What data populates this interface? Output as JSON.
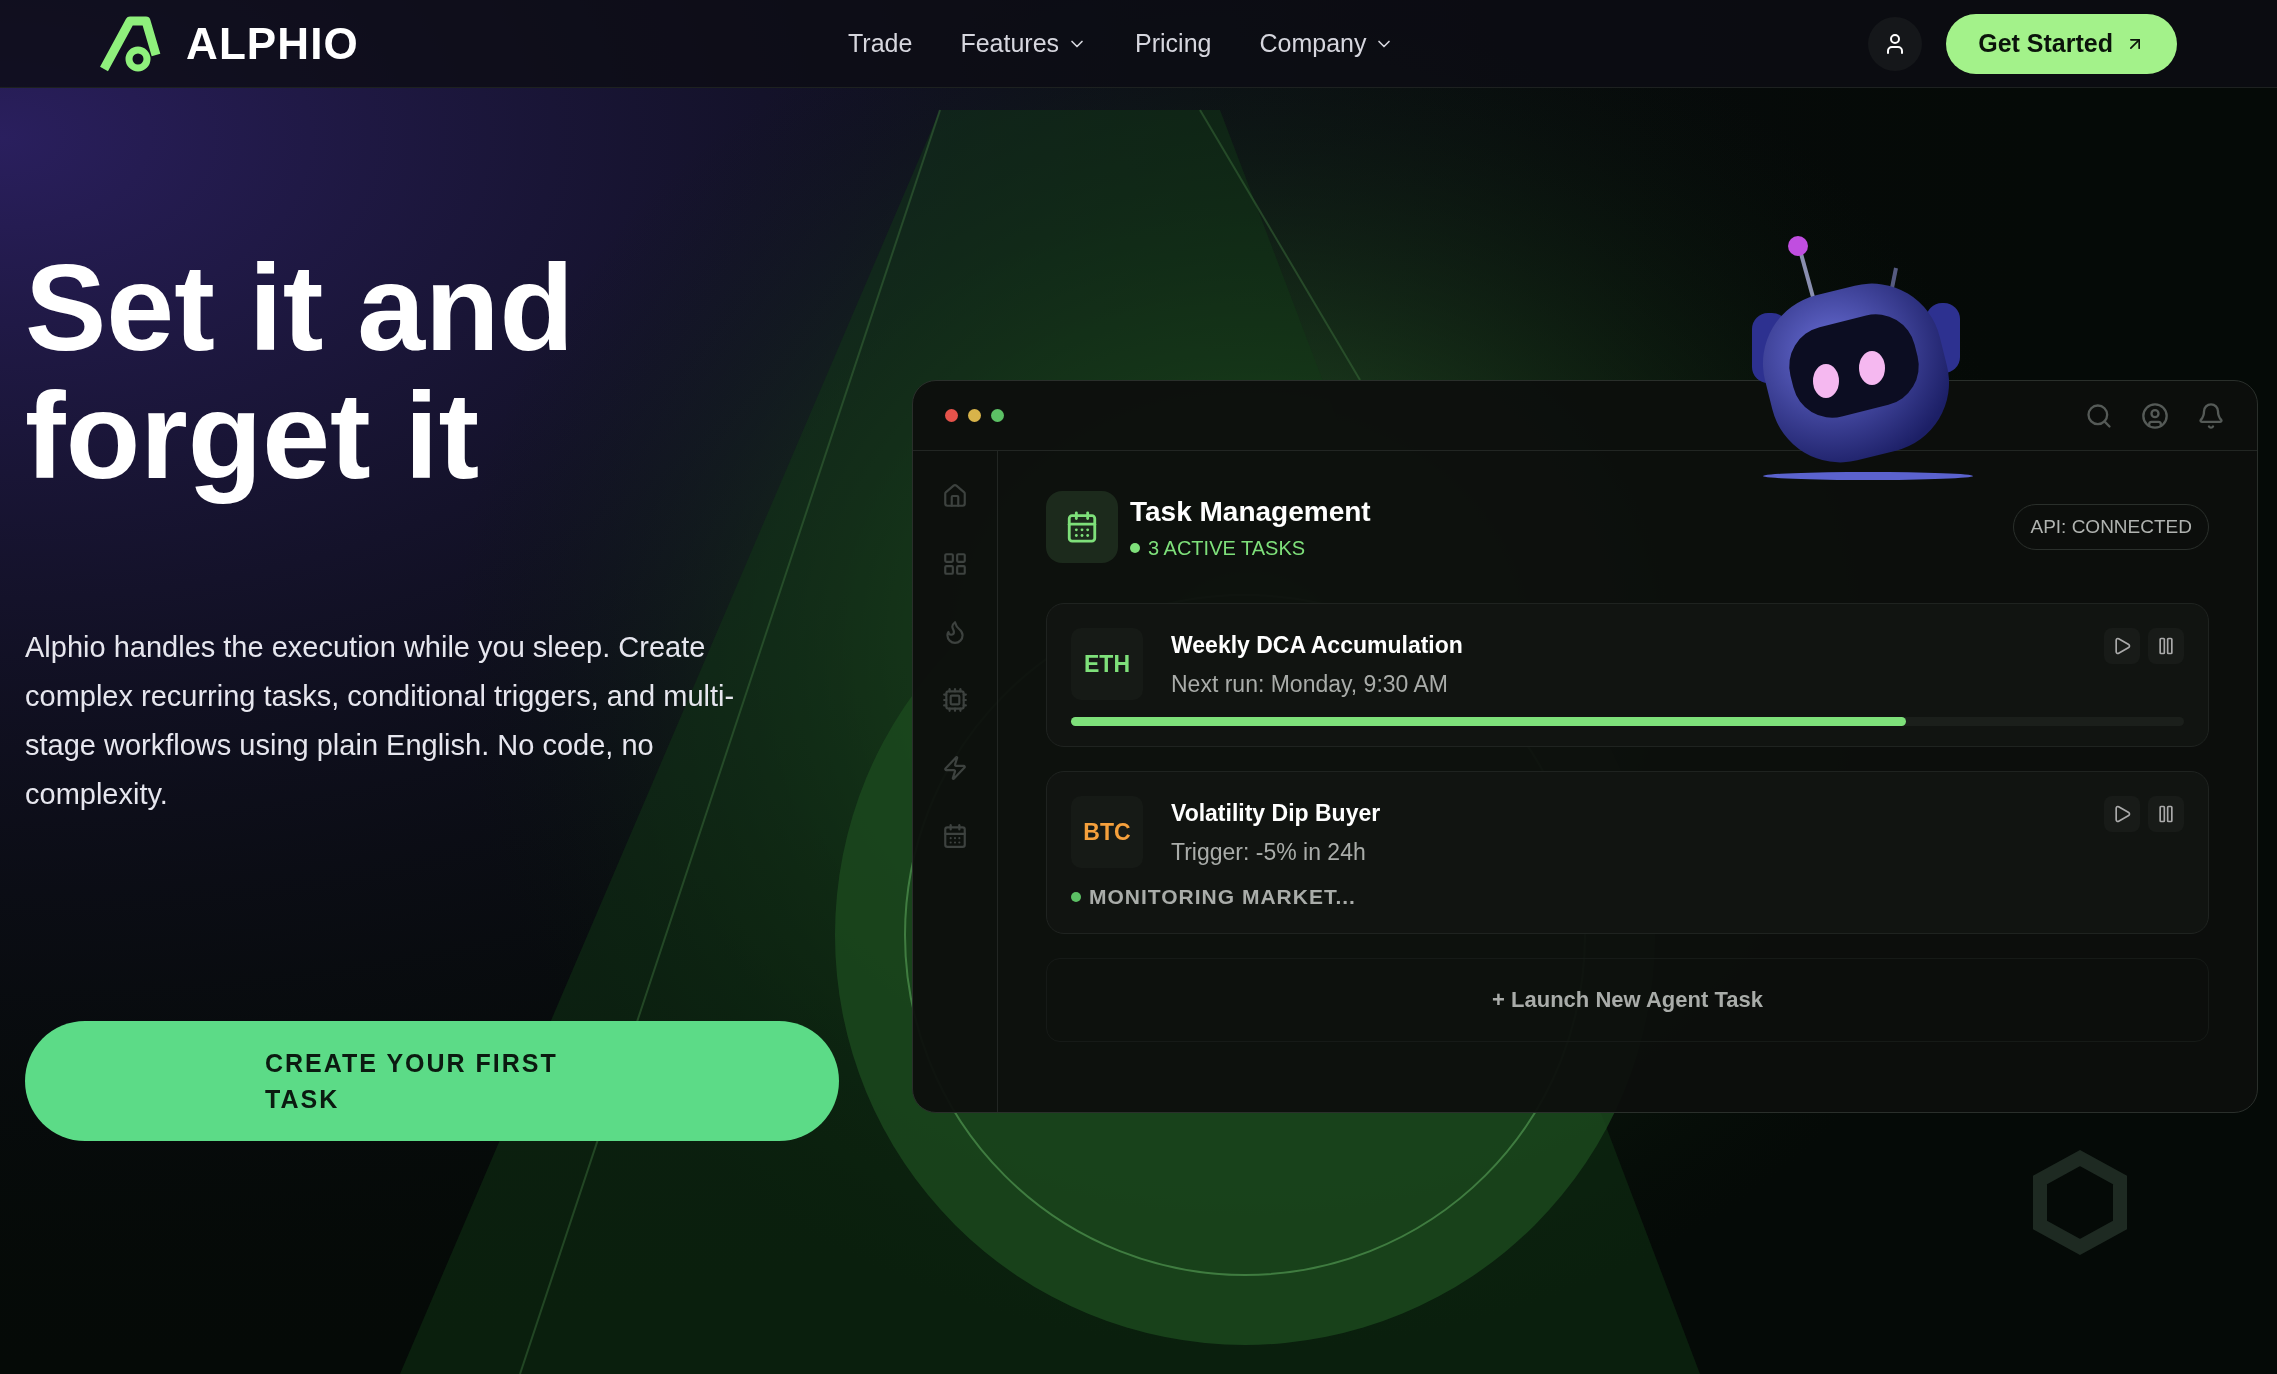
{
  "header": {
    "logo": "ALPHIO",
    "nav": [
      {
        "label": "Trade",
        "dropdown": false
      },
      {
        "label": "Features",
        "dropdown": true
      },
      {
        "label": "Pricing",
        "dropdown": false
      },
      {
        "label": "Company",
        "dropdown": true
      }
    ],
    "cta": "Get Started"
  },
  "hero": {
    "title_lines": [
      "Set it and",
      "forget it"
    ],
    "description": "Alphio handles the execution while you sleep. Create complex recurring tasks, conditional triggers, and multi-stage workflows using plain English. No code, no complexity.",
    "button": "CREATE YOUR FIRST TASK"
  },
  "dashboard": {
    "title": "Task Management",
    "subtitle": "3 ACTIVE TASKS",
    "badge": "API: CONNECTED",
    "tasks": [
      {
        "kind": "progress",
        "ticker": "ETH",
        "color": "#7ee07a",
        "name": "Weekly DCA Accumulation",
        "detail": "Next run: Monday, 9:30 AM",
        "level": 0.75
      },
      {
        "kind": "status",
        "ticker": "BTC",
        "color": "#f5a03c",
        "name": "Volatility Dip Buyer",
        "detail": "Trigger: -5% in 24h",
        "status": "MONITORING MARKET..."
      }
    ],
    "launch": "+ Launch New Agent Task"
  }
}
